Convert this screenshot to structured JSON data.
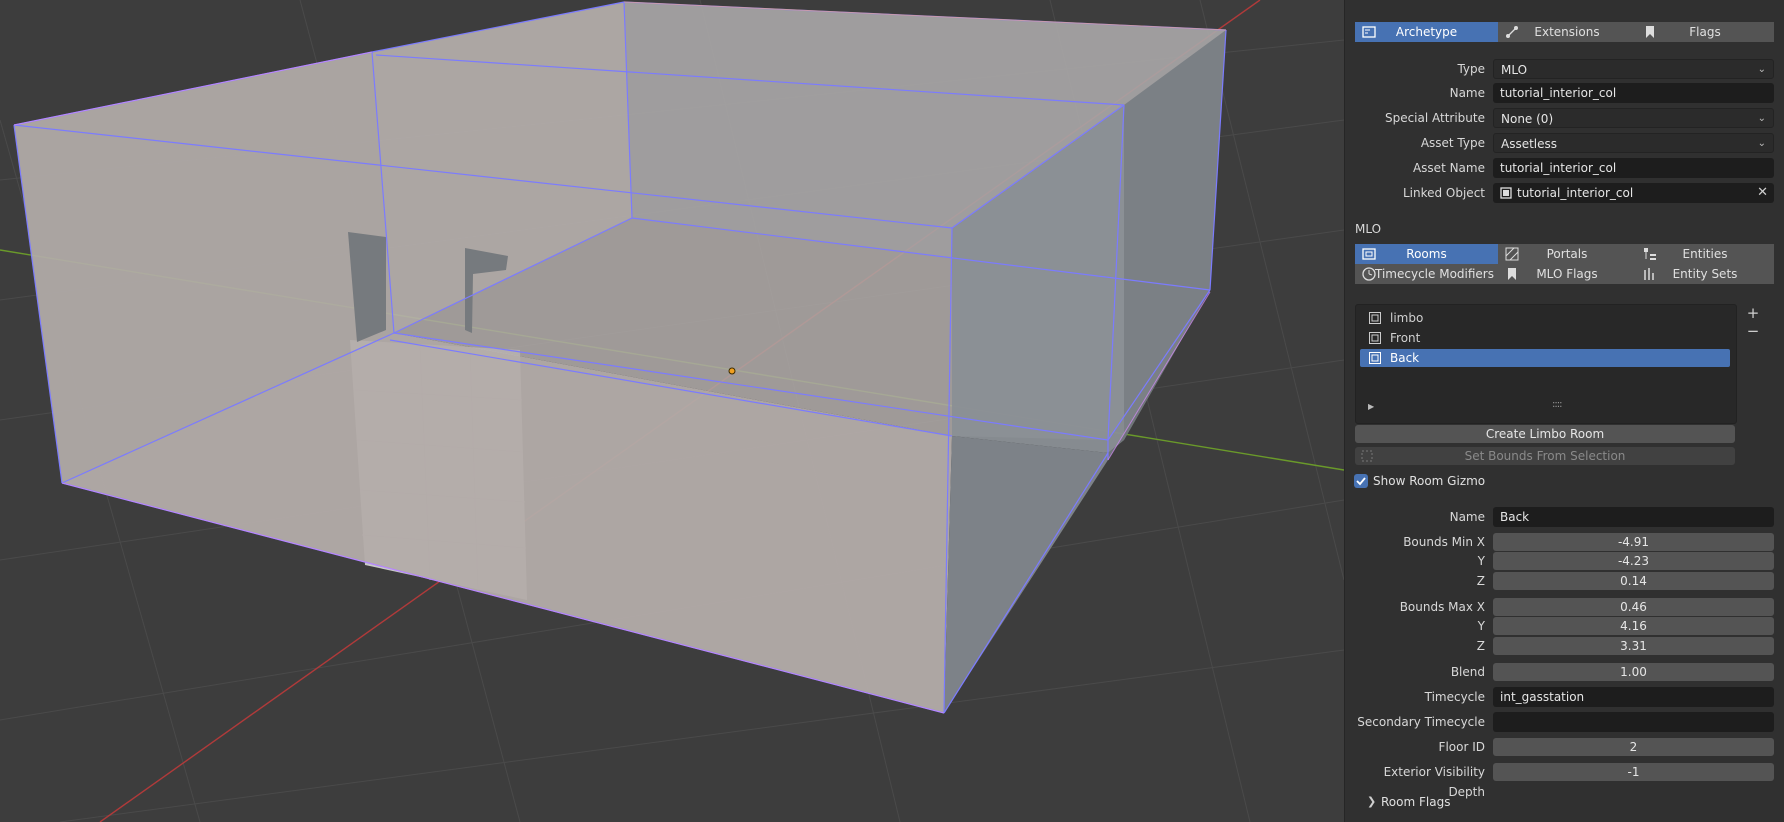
{
  "panel": {
    "top_tabs": [
      {
        "label": "Archetype",
        "icon": "archetype-icon",
        "active": true
      },
      {
        "label": "Extensions",
        "icon": "extensions-icon",
        "active": false
      },
      {
        "label": "Flags",
        "icon": "bookmark-icon",
        "active": false
      }
    ],
    "archetype": {
      "type_label": "Type",
      "type_value": "MLO",
      "name_label": "Name",
      "name_value": "tutorial_interior_col",
      "special_attribute_label": "Special Attribute",
      "special_attribute_value": "None (0)",
      "asset_type_label": "Asset Type",
      "asset_type_value": "Assetless",
      "asset_name_label": "Asset Name",
      "asset_name_value": "tutorial_interior_col",
      "linked_object_label": "Linked Object",
      "linked_object_value": "tutorial_interior_col"
    },
    "mlo_heading": "MLO",
    "mlo_tabs": [
      {
        "label": "Rooms",
        "icon": "rooms-icon",
        "active": true
      },
      {
        "label": "Portals",
        "icon": "portals-icon",
        "active": false
      },
      {
        "label": "Entities",
        "icon": "entities-icon",
        "active": false
      },
      {
        "label": "Timecycle Modifiers",
        "icon": "timecycle-icon",
        "active": false
      },
      {
        "label": "MLO Flags",
        "icon": "bookmark-icon",
        "active": false
      },
      {
        "label": "Entity Sets",
        "icon": "entity-sets-icon",
        "active": false
      }
    ],
    "rooms": [
      {
        "label": "limbo",
        "selected": false
      },
      {
        "label": "Front",
        "selected": false
      },
      {
        "label": "Back",
        "selected": true
      }
    ],
    "list_add": "+",
    "list_remove": "−",
    "create_limbo_room": "Create Limbo Room",
    "set_bounds_from_selection": "Set Bounds From Selection",
    "show_room_gizmo": {
      "label": "Show Room Gizmo",
      "checked": true
    },
    "room": {
      "name_label": "Name",
      "name_value": "Back",
      "bounds_min_x_label": "Bounds Min X",
      "bounds_min_x": "-4.91",
      "bounds_min_y_label": "Y",
      "bounds_min_y": "-4.23",
      "bounds_min_z_label": "Z",
      "bounds_min_z": "0.14",
      "bounds_max_x_label": "Bounds Max X",
      "bounds_max_x": "0.46",
      "bounds_max_y_label": "Y",
      "bounds_max_y": "4.16",
      "bounds_max_z_label": "Z",
      "bounds_max_z": "3.31",
      "blend_label": "Blend",
      "blend_value": "1.00",
      "timecycle_label": "Timecycle",
      "timecycle_value": "int_gasstation",
      "secondary_timecycle_label": "Secondary Timecycle",
      "secondary_timecycle_value": "",
      "floor_id_label": "Floor ID",
      "floor_id_value": "2",
      "exterior_visibility_depth_label": "Exterior Visibility Depth",
      "exterior_visibility_depth_value": "-1"
    },
    "room_flags_label": "Room Flags"
  },
  "colors": {
    "accent": "#4772b3",
    "panel_bg": "#303030",
    "viewport_bg": "#3d3d3d",
    "room_outline": "#7b7bff",
    "x_axis": "#b03a3a",
    "y_axis": "#6a9a2a"
  }
}
